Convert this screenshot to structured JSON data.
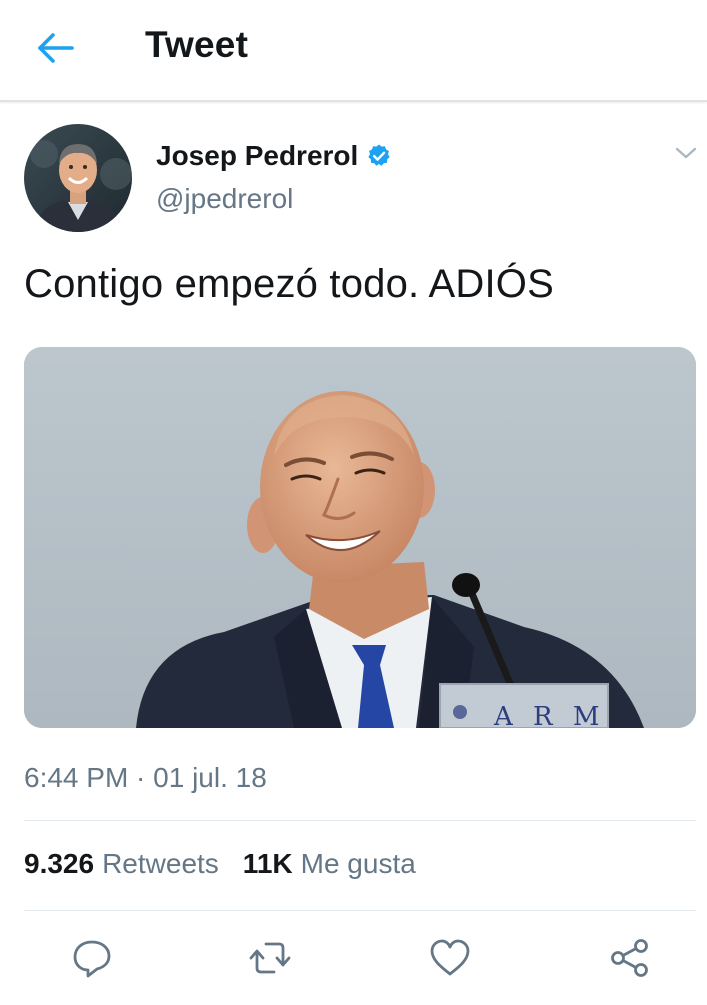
{
  "header": {
    "title": "Tweet",
    "back_icon": "back-arrow-icon",
    "accent_color": "#1da1f2"
  },
  "tweet": {
    "author": {
      "name": "Josep Pedrerol",
      "handle": "@jpedrerol",
      "verified": true
    },
    "text": "Contigo empezó todo. ADIÓS",
    "photo": {
      "podium_sign_text": "A R M"
    },
    "timestamp": "6:44 PM · 01 jul. 18",
    "stats": {
      "retweets_count": "9.326",
      "retweets_label": "Retweets",
      "likes_count": "11K",
      "likes_label": "Me gusta"
    }
  },
  "actions": {
    "icons": [
      "reply-icon",
      "retweet-icon",
      "like-icon",
      "share-icon"
    ],
    "icon_color": "#657786"
  }
}
